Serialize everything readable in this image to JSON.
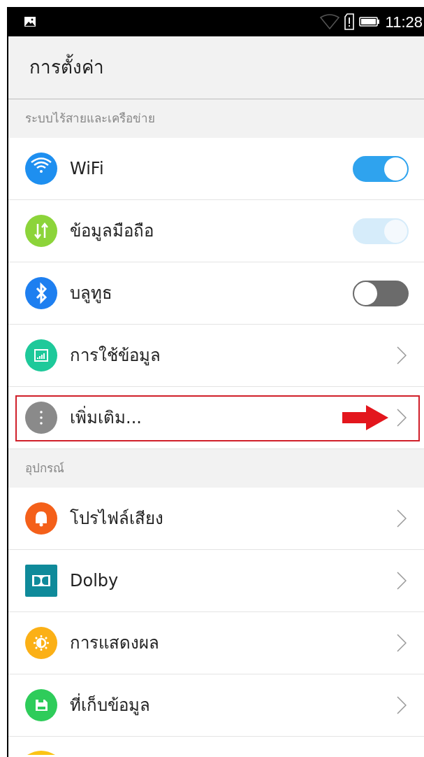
{
  "status_bar": {
    "time": "11:28"
  },
  "title": "การตั้งค่า",
  "sections": [
    {
      "header": "ระบบไร้สายและเครือข่าย",
      "items": [
        {
          "kind": "toggle",
          "label": "WiFi",
          "on": true,
          "disabled": false
        },
        {
          "kind": "toggle",
          "label": "ข้อมูลมือถือ",
          "on": true,
          "disabled": true
        },
        {
          "kind": "toggle",
          "label": "บลูทูธ",
          "on": false,
          "disabled": false
        },
        {
          "kind": "link",
          "label": "การใช้ข้อมูล",
          "highlighted": false
        },
        {
          "kind": "link",
          "label": "เพิ่มเติม...",
          "highlighted": true
        }
      ]
    },
    {
      "header": "อุปกรณ์",
      "items": [
        {
          "kind": "link",
          "label": "โปรไฟล์เสียง",
          "highlighted": false
        },
        {
          "kind": "link",
          "label": "Dolby",
          "highlighted": false
        },
        {
          "kind": "link",
          "label": "การแสดงผล",
          "highlighted": false
        },
        {
          "kind": "link",
          "label": "ที่เก็บข้อมูล",
          "highlighted": false
        }
      ]
    }
  ]
}
